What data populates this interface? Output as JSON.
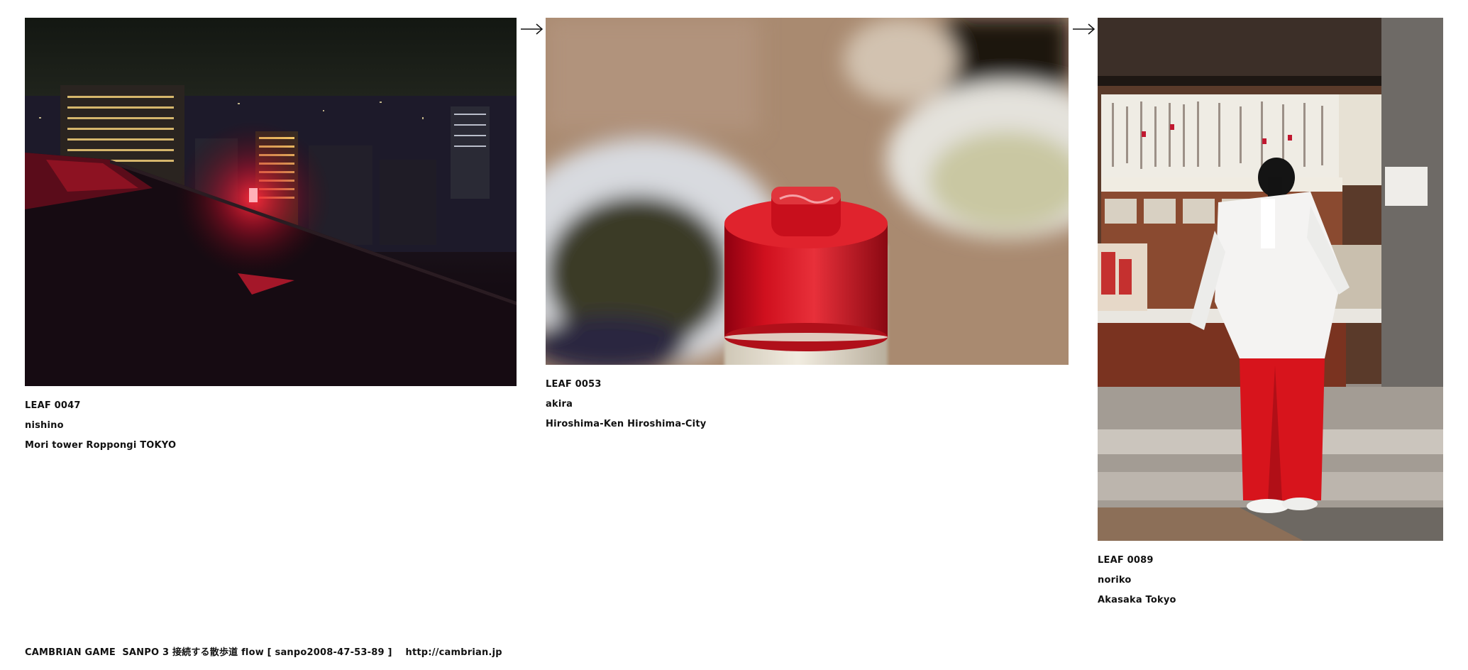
{
  "leaves": [
    {
      "id": "LEAF 0047",
      "author": "nishino",
      "location": "Mori tower Roppongi TOKYO"
    },
    {
      "id": "LEAF 0053",
      "author": "akira",
      "location": "Hiroshima-Ken Hiroshima-City"
    },
    {
      "id": "LEAF 0089",
      "author": "noriko",
      "location": "Akasaka Tokyo"
    }
  ],
  "footer": {
    "text": "CAMBRIAN GAME  SANPO 3 接続する散歩道 flow [ sanpo2008-47-53-89 ]    http://cambrian.jp"
  },
  "colors": {
    "background": "#ffffff",
    "text": "#111111",
    "arrow": "#111111"
  },
  "icons": {
    "flow_arrow": "right-arrow-icon"
  }
}
